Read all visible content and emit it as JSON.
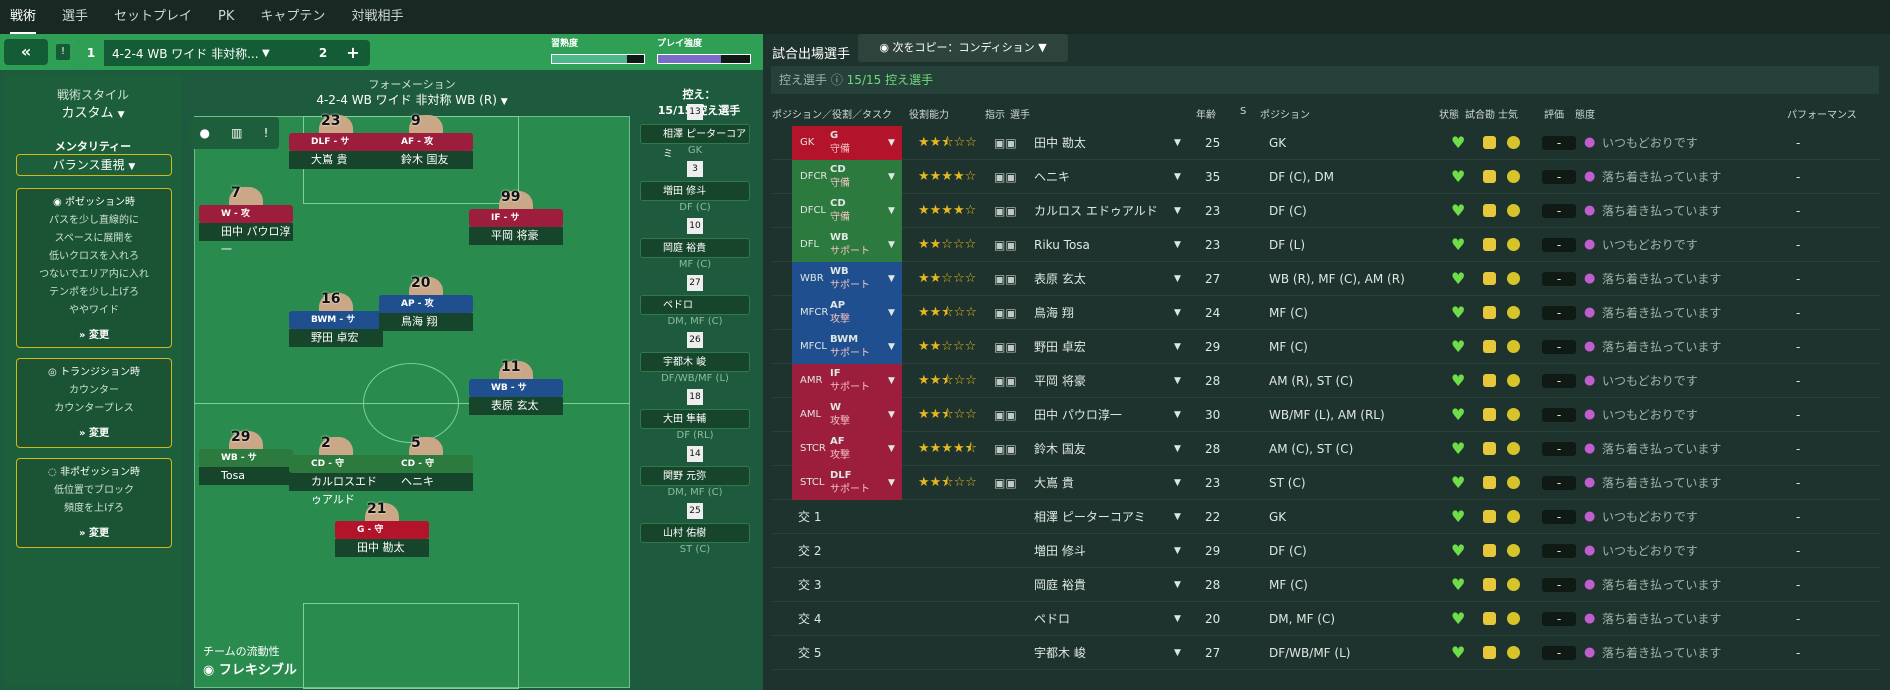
{
  "topnav": [
    "戦術",
    "選手",
    "セットプレイ",
    "PK",
    "キャプテン",
    "対戦相手"
  ],
  "tactic": {
    "name": "4-2-4 WB ワイド 非対称...",
    "slot1": "1",
    "slot2": "2",
    "fam_label": "習熟度",
    "intensity_label": "プレイ強度",
    "fam_pct": 0.82,
    "int_pct": 0.68
  },
  "style": {
    "title": "戦術スタイル",
    "value": "カスタム",
    "ment_label": "メンタリティー",
    "ment_value": "バランス重視",
    "pos_title": "ポゼッション時",
    "pos_lines": [
      "パスを少し直線的に",
      "スペースに展開を",
      "低いクロスを入れろ",
      "つないでエリア内に入れ",
      "テンポを少し上げろ",
      "ややワイド"
    ],
    "tra_title": "トランジション時",
    "tra_lines": [
      "カウンター",
      "カウンタープレス"
    ],
    "def_title": "非ポゼッション時",
    "def_lines": [
      "低位置でブロック",
      "頻度を上げろ"
    ],
    "change": "変更"
  },
  "formation": {
    "label": "フォーメーション",
    "name": "4-2-4 WB ワイド 非対称 WB (R)",
    "fluidity_label": "チームの流動性",
    "fluidity": "フレキシブル"
  },
  "subs": {
    "label": "控え：",
    "count": "15/15 控え選手",
    "items": [
      {
        "n": "13",
        "name": "相澤 ピーターコアミ",
        "pos": "GK"
      },
      {
        "n": "3",
        "name": "増田 修斗",
        "pos": "DF (C)"
      },
      {
        "n": "10",
        "name": "岡庭 裕貴",
        "pos": "MF (C)"
      },
      {
        "n": "27",
        "name": "ペドロ",
        "pos": "DM, MF (C)"
      },
      {
        "n": "26",
        "name": "宇都木 峻",
        "pos": "DF/WB/MF (L)"
      },
      {
        "n": "18",
        "name": "大田 隼輔",
        "pos": "DF (RL)"
      },
      {
        "n": "14",
        "name": "関野 元弥",
        "pos": "DM, MF (C)"
      },
      {
        "n": "25",
        "name": "山村 佑樹",
        "pos": "ST (C)"
      }
    ]
  },
  "players": [
    {
      "n": "23",
      "role": "DLF - サ",
      "name": "大嶌 貴",
      "c": "#9c1d3c"
    },
    {
      "n": "9",
      "role": "AF - 攻",
      "name": "鈴木 国友",
      "c": "#9c1d3c"
    },
    {
      "n": "7",
      "role": "W - 攻",
      "name": "田中 パウロ淳一",
      "c": "#9c1d3c"
    },
    {
      "n": "99",
      "role": "IF - サ",
      "name": "平岡 将豪",
      "c": "#9c1d3c"
    },
    {
      "n": "16",
      "role": "BWM - サ",
      "name": "野田 卓宏",
      "c": "#1f4f8f"
    },
    {
      "n": "20",
      "role": "AP - 攻",
      "name": "鳥海 翔",
      "c": "#1f4f8f"
    },
    {
      "n": "11",
      "role": "WB - サ",
      "name": "表原 玄太",
      "c": "#1f4f8f"
    },
    {
      "n": "29",
      "role": "WB - サ",
      "name": "Tosa",
      "c": "#2c7a3e"
    },
    {
      "n": "2",
      "role": "CD - 守",
      "name": "カルロスエドゥアルド",
      "c": "#2c7a3e"
    },
    {
      "n": "5",
      "role": "CD - 守",
      "name": "ヘニキ",
      "c": "#2c7a3e"
    },
    {
      "n": "21",
      "role": "G - 守",
      "name": "田中 勘太",
      "c": "#b3132b"
    }
  ],
  "right": {
    "title": "試合出場選手",
    "copy_btn": "次をコピー：コンディション",
    "subs_label": "控え選手",
    "subs_count": "15/15 控え選手",
    "headers": [
      "ポジション／役割／タスク",
      "役割能力",
      "指示",
      "選手",
      "年齢",
      "S",
      "ポジション",
      "状態",
      "試合勘",
      "士気",
      "評価",
      "態度",
      "パフォーマンス"
    ],
    "rows": [
      {
        "pos": "GK",
        "role": "G",
        "duty": "守備",
        "stars": "2.5",
        "name": "田中 勘太",
        "age": "25",
        "positions": "GK",
        "attitude": "いつもどおりです",
        "c": "#b3132b"
      },
      {
        "pos": "DFCR",
        "role": "CD",
        "duty": "守備",
        "stars": "4",
        "name": "ヘニキ",
        "age": "35",
        "positions": "DF (C), DM",
        "attitude": "落ち着き払っています",
        "c": "#2c7a3e"
      },
      {
        "pos": "DFCL",
        "role": "CD",
        "duty": "守備",
        "stars": "4",
        "name": "カルロス エドゥアルド",
        "age": "23",
        "positions": "DF (C)",
        "attitude": "落ち着き払っています",
        "c": "#2c7a3e"
      },
      {
        "pos": "DFL",
        "role": "WB",
        "duty": "サポート",
        "stars": "2",
        "name": "Riku Tosa",
        "age": "23",
        "positions": "DF (L)",
        "attitude": "いつもどおりです",
        "c": "#2c7a3e"
      },
      {
        "pos": "WBR",
        "role": "WB",
        "duty": "サポート",
        "stars": "2",
        "name": "表原 玄太",
        "age": "27",
        "positions": "WB (R), MF (C), AM (R)",
        "attitude": "落ち着き払っています",
        "c": "#1f4f8f"
      },
      {
        "pos": "MFCR",
        "role": "AP",
        "duty": "攻撃",
        "stars": "2.5",
        "name": "鳥海 翔",
        "age": "24",
        "positions": "MF (C)",
        "attitude": "落ち着き払っています",
        "c": "#1f4f8f"
      },
      {
        "pos": "MFCL",
        "role": "BWM",
        "duty": "サポート",
        "stars": "2",
        "name": "野田 卓宏",
        "age": "29",
        "positions": "MF (C)",
        "attitude": "落ち着き払っています",
        "c": "#1f4f8f"
      },
      {
        "pos": "AMR",
        "role": "IF",
        "duty": "サポート",
        "stars": "2.5",
        "name": "平岡 将豪",
        "age": "28",
        "positions": "AM (R), ST (C)",
        "attitude": "いつもどおりです",
        "c": "#9c1d3c"
      },
      {
        "pos": "AML",
        "role": "W",
        "duty": "攻撃",
        "stars": "2.5",
        "name": "田中 パウロ淳一",
        "age": "30",
        "positions": "WB/MF (L), AM (RL)",
        "attitude": "いつもどおりです",
        "c": "#9c1d3c"
      },
      {
        "pos": "STCR",
        "role": "AF",
        "duty": "攻撃",
        "stars": "4.5",
        "name": "鈴木 国友",
        "age": "28",
        "positions": "AM (C), ST (C)",
        "attitude": "落ち着き払っています",
        "c": "#9c1d3c"
      },
      {
        "pos": "STCL",
        "role": "DLF",
        "duty": "サポート",
        "stars": "2.5",
        "name": "大嶌 貴",
        "age": "23",
        "positions": "ST (C)",
        "attitude": "落ち着き払っています",
        "c": "#9c1d3c"
      },
      {
        "pos": "交 1",
        "role": "",
        "duty": "",
        "stars": "",
        "name": "相澤 ピーターコアミ",
        "age": "22",
        "positions": "GK",
        "attitude": "いつもどおりです",
        "c": ""
      },
      {
        "pos": "交 2",
        "role": "",
        "duty": "",
        "stars": "",
        "name": "増田 修斗",
        "age": "29",
        "positions": "DF (C)",
        "attitude": "いつもどおりです",
        "c": ""
      },
      {
        "pos": "交 3",
        "role": "",
        "duty": "",
        "stars": "",
        "name": "岡庭 裕貴",
        "age": "28",
        "positions": "MF (C)",
        "attitude": "落ち着き払っています",
        "c": ""
      },
      {
        "pos": "交 4",
        "role": "",
        "duty": "",
        "stars": "",
        "name": "ペドロ",
        "age": "20",
        "positions": "DM, MF (C)",
        "attitude": "落ち着き払っています",
        "c": ""
      },
      {
        "pos": "交 5",
        "role": "",
        "duty": "",
        "stars": "",
        "name": "宇都木 峻",
        "age": "27",
        "positions": "DF/WB/MF (L)",
        "attitude": "落ち着き払っています",
        "c": ""
      }
    ],
    "rating": "-",
    "performance": "-"
  }
}
